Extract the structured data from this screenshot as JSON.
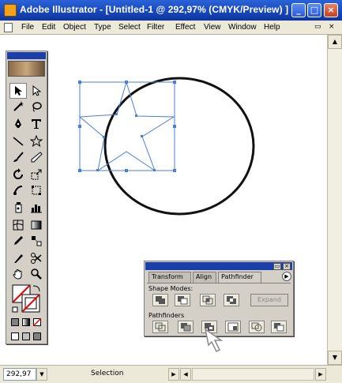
{
  "window": {
    "title": "Adobe Illustrator - [Untitled-1 @ 292,97% (CMYK/Preview) ]",
    "controls": {
      "minimize": "_",
      "maximize": "□",
      "close": "×"
    }
  },
  "menubar": {
    "items": [
      "File",
      "Edit",
      "Object",
      "Type",
      "Select",
      "Filter",
      "Effect",
      "View",
      "Window",
      "Help"
    ],
    "doc_controls": {
      "restore": "▭",
      "close": "×"
    }
  },
  "statusbar": {
    "zoom": "292,97",
    "status": "Selection"
  },
  "pathfinder": {
    "tabs": [
      "Transform",
      "Align",
      "Pathfinder"
    ],
    "active_tab": "Pathfinder",
    "shape_modes_label": "Shape Modes:",
    "pathfinders_label": "Pathfinders",
    "expand_label": "Expand"
  },
  "colors": {
    "selection": "#4a7fd6",
    "titlebar": "#1746b7"
  }
}
